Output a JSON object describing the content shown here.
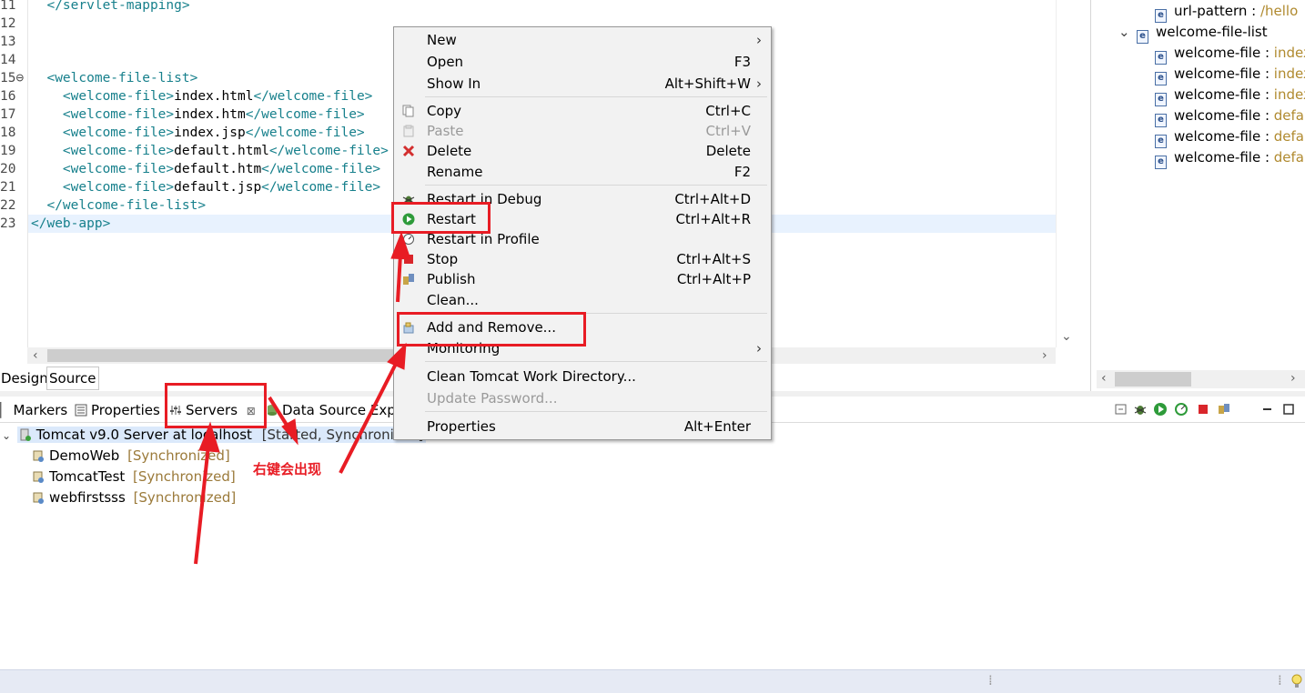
{
  "editor": {
    "lines": [
      {
        "num": "11",
        "parts": [
          [
            "tag",
            "  </servlet-mapping>"
          ]
        ]
      },
      {
        "num": "12",
        "parts": []
      },
      {
        "num": "13",
        "parts": []
      },
      {
        "num": "14",
        "parts": []
      },
      {
        "num": "15⊖",
        "parts": [
          [
            "tag",
            "  <welcome-file-list>"
          ]
        ]
      },
      {
        "num": "16",
        "parts": [
          [
            "tag",
            "    <welcome-file>"
          ],
          [
            "txt",
            "index.html"
          ],
          [
            "tag",
            "</welcome-file>"
          ]
        ]
      },
      {
        "num": "17",
        "parts": [
          [
            "tag",
            "    <welcome-file>"
          ],
          [
            "txt",
            "index.htm"
          ],
          [
            "tag",
            "</welcome-file>"
          ]
        ]
      },
      {
        "num": "18",
        "parts": [
          [
            "tag",
            "    <welcome-file>"
          ],
          [
            "txt",
            "index.jsp"
          ],
          [
            "tag",
            "</welcome-file>"
          ]
        ]
      },
      {
        "num": "19",
        "parts": [
          [
            "tag",
            "    <welcome-file>"
          ],
          [
            "txt",
            "default.html"
          ],
          [
            "tag",
            "</welcome-file>"
          ]
        ]
      },
      {
        "num": "20",
        "parts": [
          [
            "tag",
            "    <welcome-file>"
          ],
          [
            "txt",
            "default.htm"
          ],
          [
            "tag",
            "</welcome-file>"
          ]
        ]
      },
      {
        "num": "21",
        "parts": [
          [
            "tag",
            "    <welcome-file>"
          ],
          [
            "txt",
            "default.jsp"
          ],
          [
            "tag",
            "</welcome-file>"
          ]
        ]
      },
      {
        "num": "22",
        "parts": [
          [
            "tag",
            "  </welcome-file-list>"
          ]
        ]
      },
      {
        "num": "23",
        "parts": [
          [
            "tag",
            "</web-app>"
          ]
        ]
      }
    ],
    "tab_design": "Design",
    "tab_source": "Source"
  },
  "outline": {
    "items": [
      {
        "label": "url-pattern : ",
        "value": "/hello",
        "indent": 1
      },
      {
        "label": "welcome-file-list",
        "value": "",
        "indent": 0
      },
      {
        "label": "welcome-file : ",
        "value": "index",
        "indent": 1
      },
      {
        "label": "welcome-file : ",
        "value": "index",
        "indent": 1
      },
      {
        "label": "welcome-file : ",
        "value": "index",
        "indent": 1
      },
      {
        "label": "welcome-file : ",
        "value": "defau",
        "indent": 1
      },
      {
        "label": "welcome-file : ",
        "value": "defau",
        "indent": 1
      },
      {
        "label": "welcome-file : ",
        "value": "defau",
        "indent": 1
      }
    ]
  },
  "panel": {
    "tabs": {
      "markers": "Markers",
      "properties": "Properties",
      "servers": "Servers",
      "datasource": "Data Source Explo"
    },
    "server": {
      "name": "Tomcat v9.0 Server at localhost",
      "state": "[Started, Synchronized]"
    },
    "modules": [
      {
        "name": "DemoWeb",
        "state": "[Synchronized]"
      },
      {
        "name": "TomcatTest",
        "state": "[Synchronized]"
      },
      {
        "name": "webfirstsss",
        "state": "[Synchronized]"
      }
    ]
  },
  "menu": {
    "new": "New",
    "open": "Open",
    "open_sc": "F3",
    "showin": "Show In",
    "showin_sc": "Alt+Shift+W",
    "copy": "Copy",
    "copy_sc": "Ctrl+C",
    "paste": "Paste",
    "paste_sc": "Ctrl+V",
    "delete": "Delete",
    "delete_sc": "Delete",
    "rename": "Rename",
    "rename_sc": "F2",
    "restart_debug": "Restart in Debug",
    "restart_debug_sc": "Ctrl+Alt+D",
    "restart": "Restart",
    "restart_sc": "Ctrl+Alt+R",
    "restart_profile": "Restart in Profile",
    "stop": "Stop",
    "stop_sc": "Ctrl+Alt+S",
    "publish": "Publish",
    "publish_sc": "Ctrl+Alt+P",
    "clean": "Clean...",
    "add_remove": "Add and Remove...",
    "monitoring": "Monitoring",
    "clean_tomcat": "Clean Tomcat Work Directory...",
    "update_password": "Update Password...",
    "properties": "Properties",
    "properties_sc": "Alt+Enter",
    "submenu_glyph": "›"
  },
  "annotation": {
    "text": "右键会出现",
    "color": "#e81c24"
  },
  "colors": {
    "xml_tag": "#17808c",
    "sync_text": "#9b7a3a",
    "selection": "#dbe9fb"
  }
}
